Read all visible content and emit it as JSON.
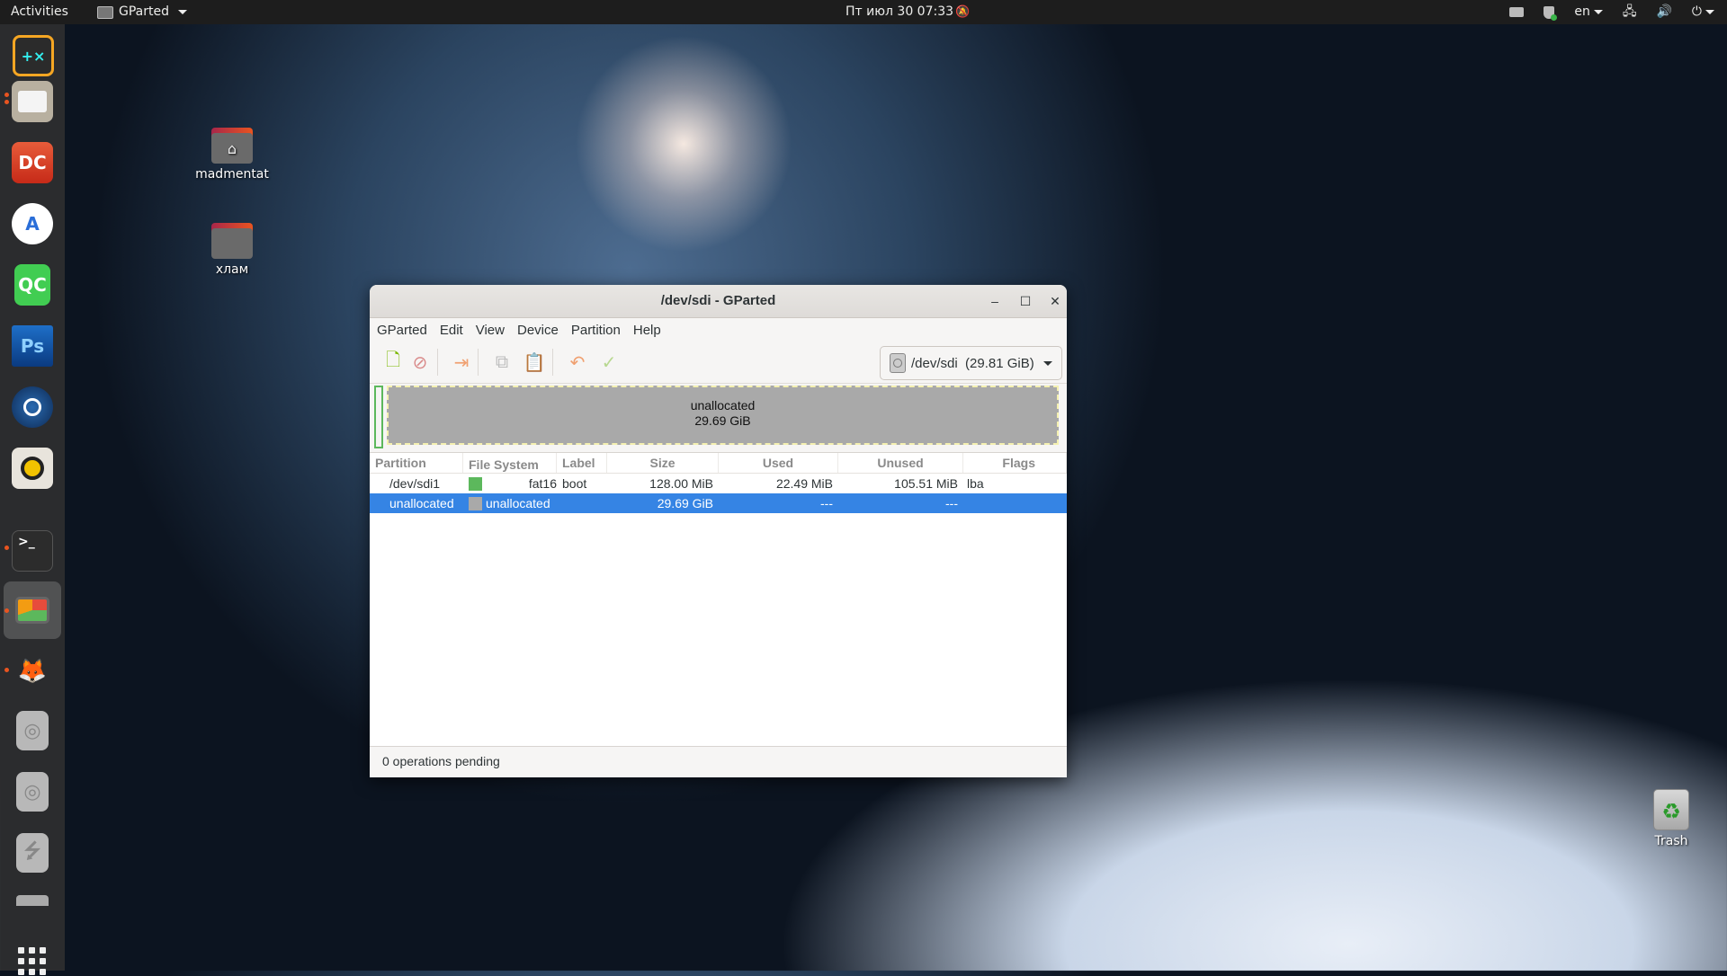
{
  "topbar": {
    "activities": "Activities",
    "app_menu": "GParted",
    "clock": "Пт июл 30  07:33",
    "keyboard_layout": "en"
  },
  "dock": {
    "items": [
      {
        "name": "calculator",
        "label": ""
      },
      {
        "name": "files",
        "label": "",
        "running": true
      },
      {
        "name": "double-commander",
        "label": "DC"
      },
      {
        "name": "android-studio",
        "label": ""
      },
      {
        "name": "qt-creator",
        "label": "QC"
      },
      {
        "name": "photoshop",
        "label": "Ps"
      },
      {
        "name": "steam",
        "label": ""
      },
      {
        "name": "rhythmbox",
        "label": ""
      },
      {
        "name": "terminal",
        "label": ">_",
        "running": true
      },
      {
        "name": "gparted",
        "label": "",
        "running": true,
        "active": true
      },
      {
        "name": "gimp",
        "label": "",
        "running": true
      },
      {
        "name": "optical-drive-1",
        "label": ""
      },
      {
        "name": "optical-drive-2",
        "label": ""
      },
      {
        "name": "usb-drive",
        "label": ""
      }
    ]
  },
  "desktop": {
    "icons": [
      {
        "label": "madmentat",
        "type": "home-folder"
      },
      {
        "label": "хлам",
        "type": "folder"
      },
      {
        "label": "Trash",
        "type": "trash"
      }
    ]
  },
  "window": {
    "title": "/dev/sdi - GParted",
    "menu": [
      "GParted",
      "Edit",
      "View",
      "Device",
      "Partition",
      "Help"
    ],
    "toolbar": {
      "buttons": [
        "new",
        "delete",
        "resize-move",
        "copy",
        "paste",
        "undo",
        "apply"
      ]
    },
    "device_selector": {
      "device": "/dev/sdi",
      "size": "(29.81 GiB)"
    },
    "disk_map": {
      "unallocated_label": "unallocated",
      "unallocated_size": "29.69 GiB"
    },
    "table": {
      "columns": [
        "Partition",
        "File System",
        "Label",
        "Size",
        "Used",
        "Unused",
        "Flags"
      ],
      "rows": [
        {
          "partition": "/dev/sdi1",
          "fs_color": "#5cb85c",
          "filesystem": "fat16",
          "label": "boot",
          "size": "128.00 MiB",
          "used": "22.49 MiB",
          "unused": "105.51 MiB",
          "flags": "lba",
          "selected": false
        },
        {
          "partition": "unallocated",
          "fs_color": "#a9a9a9",
          "filesystem": "unallocated",
          "label": "",
          "size": "29.69 GiB",
          "used": "---",
          "unused": "---",
          "flags": "",
          "selected": true
        }
      ]
    },
    "status": "0 operations pending"
  },
  "colors": {
    "selection": "#3584e4",
    "fat16": "#5cb85c",
    "unallocated": "#a9a9a9",
    "accent_dot": "#e95420"
  }
}
